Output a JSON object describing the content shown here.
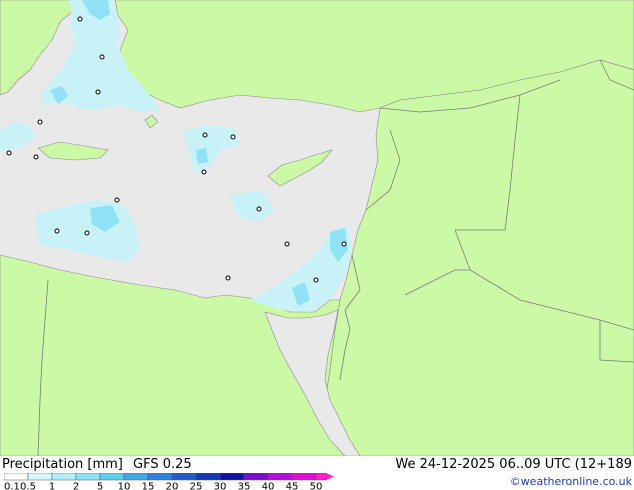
{
  "title": "Precipitation [mm]",
  "model": "GFS 0.25",
  "valid_time": "We 24-12-2025 06..09 UTC (12+189",
  "credit": "©weatheronline.co.uk",
  "legend": {
    "labels": [
      "0.1",
      "0.5",
      "1",
      "2",
      "5",
      "10",
      "15",
      "20",
      "25",
      "30",
      "35",
      "40",
      "45",
      "50"
    ],
    "colors": [
      "#ffffff",
      "#d8f7ff",
      "#b4eefc",
      "#8ce2f7",
      "#5ccff0",
      "#41a7e6",
      "#2f82d8",
      "#1f5dcb",
      "#1437b8",
      "#1015a0",
      "#7a0fc8",
      "#b60fd6",
      "#e010d0",
      "#ff1fd0"
    ]
  },
  "colors": {
    "sea": "#e9e9e9",
    "land": "#ccf9a5",
    "precip_light": "#c8f2f8",
    "precip_medium": "#8fe2f5"
  }
}
